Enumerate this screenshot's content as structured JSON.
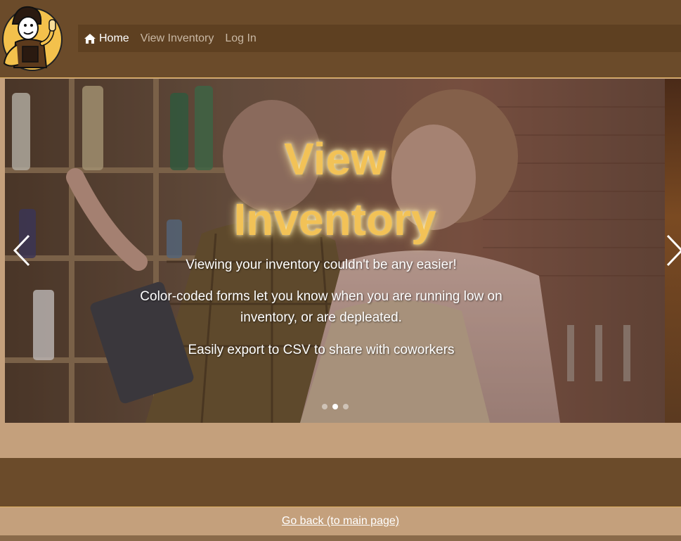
{
  "nav": {
    "items": [
      {
        "label": "Home",
        "icon": "home-icon",
        "active": true
      },
      {
        "label": "View Inventory",
        "active": false
      },
      {
        "label": "Log In",
        "active": false
      }
    ]
  },
  "carousel": {
    "title_line1": "View",
    "title_line2": "Inventory",
    "paragraph1": "Viewing your inventory couldn't be any easier!",
    "paragraph2": "Color-coded forms let you know when you are running low on inventory, or are depleated.",
    "paragraph3": "Easily export to CSV to share with coworkers",
    "slide_count": 3,
    "active_slide": 2
  },
  "footer": {
    "link_text": "Go back (to main page)"
  },
  "colors": {
    "header_bg": "#6b4b2a",
    "navbar_bg": "#5e4021",
    "page_bg": "#c4a07c",
    "accent_gold": "#f2c257",
    "border_gold": "#e0b264"
  }
}
